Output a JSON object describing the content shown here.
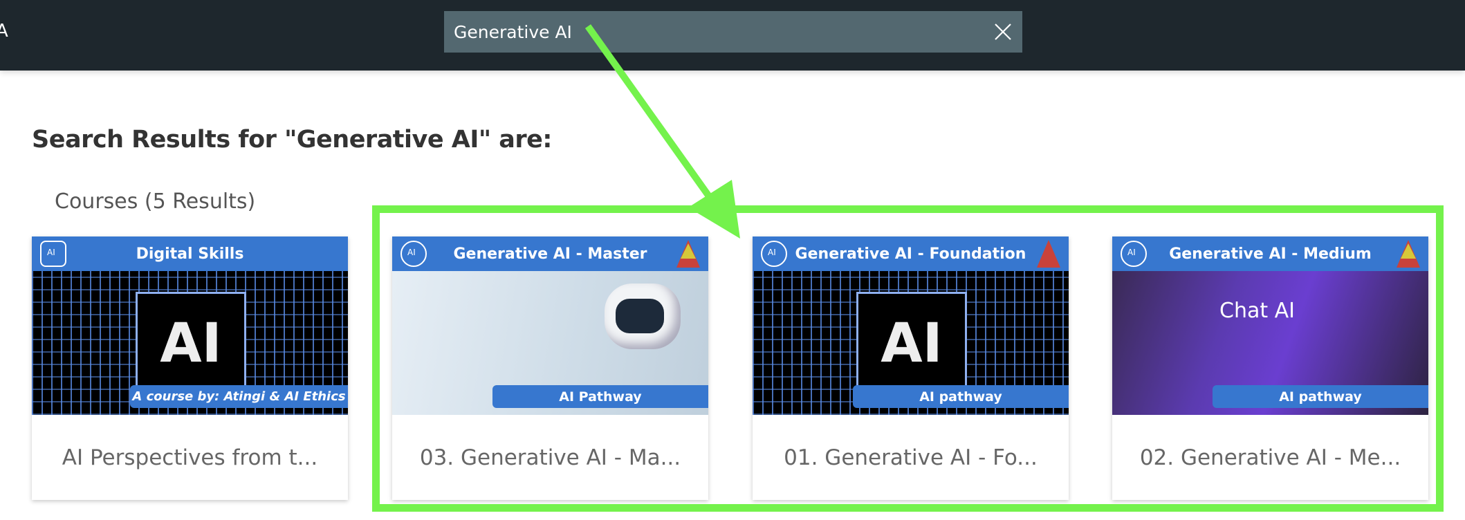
{
  "header": {
    "logo_fragment": "A",
    "search": {
      "value": "Generative AI",
      "clear_icon": "close-icon"
    }
  },
  "main": {
    "title": "Search Results for \"Generative AI\" are:",
    "section_label": "Courses (5 Results)",
    "courses": [
      {
        "banner": "Digital Skills",
        "image_text": "AI",
        "badge": "A course by: Atingi & AI Ethics",
        "title": "AI Perspectives from t..."
      },
      {
        "banner": "Generative AI - Master",
        "badge": "AI Pathway",
        "title": "03. Generative AI - Ma..."
      },
      {
        "banner": "Generative AI - Foundation",
        "image_text": "AI",
        "badge": "AI pathway",
        "title": "01. Generative AI - Fo..."
      },
      {
        "banner": "Generative AI - Medium",
        "image_text": "Chat AI",
        "badge": "AI pathway",
        "title": "02. Generative AI - Me..."
      }
    ]
  },
  "annotation": {
    "highlight_color": "#74f24c"
  },
  "colors": {
    "header_bg": "#1e272d",
    "search_bg": "#536870",
    "brand_blue": "#3777cf"
  }
}
